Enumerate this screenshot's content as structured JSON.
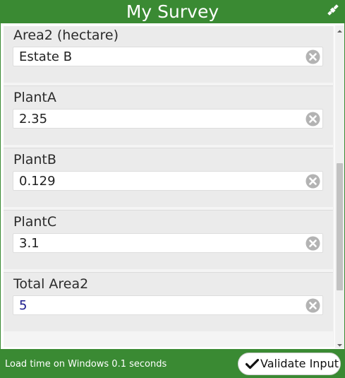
{
  "app": {
    "title": "My Survey",
    "title_icon": "satellite-icon"
  },
  "form": {
    "fields": [
      {
        "label": "Area2 (hectare)",
        "value": "Estate B"
      },
      {
        "label": "PlantA",
        "value": "2.35"
      },
      {
        "label": "PlantB",
        "value": "0.129"
      },
      {
        "label": "PlantC",
        "value": "3.1"
      },
      {
        "label": "Total Area2",
        "value": "5"
      }
    ],
    "clear_icon": "clear-circle-icon",
    "computed_value_color": "#1a1a8c"
  },
  "footer": {
    "status": "Load time on Windows 0.1 seconds",
    "validate_label": "Validate Input",
    "validate_icon": "checkmark-icon"
  },
  "colors": {
    "brand": "#3a8a33",
    "field_background": "#ebebeb",
    "content_background": "#f4f4f4"
  }
}
